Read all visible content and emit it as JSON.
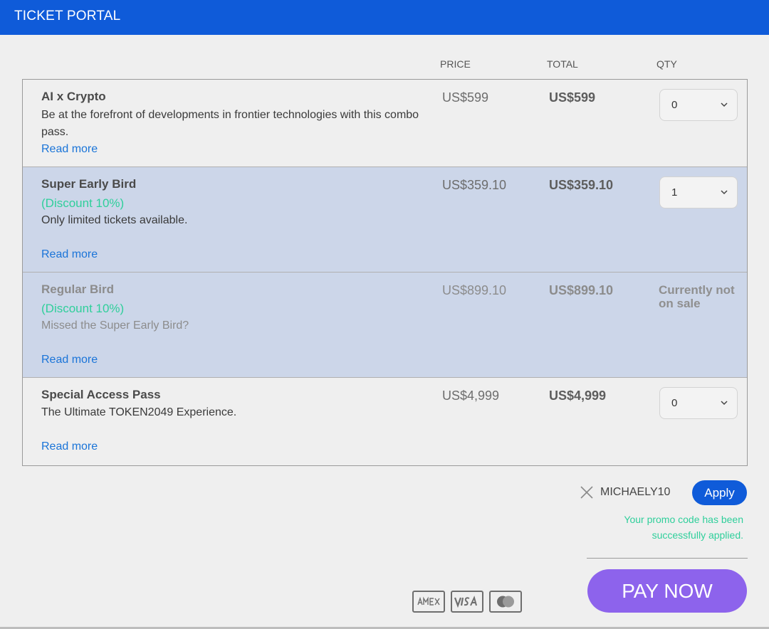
{
  "header": {
    "title": "TICKET PORTAL"
  },
  "columns": {
    "price": "PRICE",
    "total": "TOTAL",
    "qty": "QTY"
  },
  "tickets": [
    {
      "name": "AI x Crypto",
      "discount": "",
      "description": "Be at the forefront of developments in frontier technologies with this combo pass.",
      "read_more": "Read more",
      "price": "US$599",
      "total": "US$599",
      "qty": "0",
      "status": ""
    },
    {
      "name": "Super Early Bird",
      "discount": "(Discount 10%)",
      "description": "Only limited tickets available.",
      "read_more": "Read more",
      "price": "US$359.10",
      "total": "US$359.10",
      "qty": "1",
      "status": ""
    },
    {
      "name": "Regular Bird",
      "discount": "(Discount 10%)",
      "description": "Missed the Super Early Bird?",
      "read_more": "Read more",
      "price": "US$899.10",
      "total": "US$899.10",
      "qty": "",
      "status": "Currently not on sale"
    },
    {
      "name": "Special Access Pass",
      "discount": "",
      "description": "The Ultimate TOKEN2049 Experience.",
      "read_more": "Read more",
      "price": "US$4,999",
      "total": "US$4,999",
      "qty": "0",
      "status": ""
    }
  ],
  "promo": {
    "code": "MICHAELY10",
    "apply_label": "Apply",
    "message": "Your promo code has been successfully applied."
  },
  "payment": {
    "pay_label": "PAY NOW",
    "cards": [
      "amex-icon",
      "visa-icon",
      "mastercard-icon"
    ]
  },
  "colors": {
    "header_bg": "#0f5bd9",
    "highlight_row": "#ccd6e9",
    "discount": "#2fcf9b",
    "link": "#1a74d8",
    "pay_button": "#8d63ec"
  }
}
